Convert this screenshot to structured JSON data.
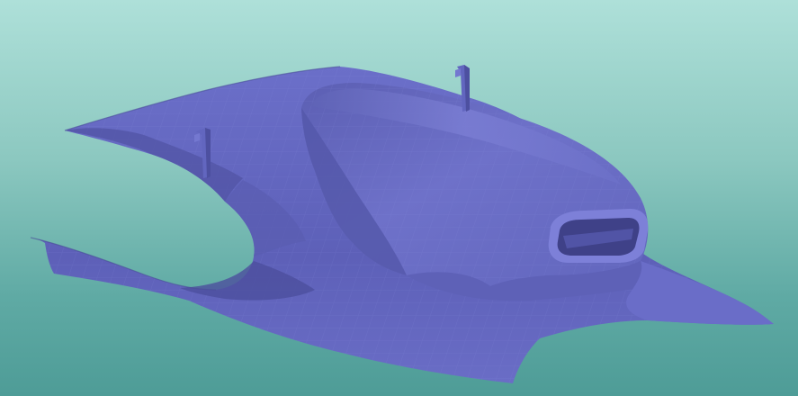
{
  "viewport": {
    "background_top": "#aee0d9",
    "background_bottom": "#4e9c97",
    "model_color": "#6f72c8"
  },
  "model": {
    "shape": "3d-car-body-surface-mesh",
    "shading": "flat-faceted"
  }
}
